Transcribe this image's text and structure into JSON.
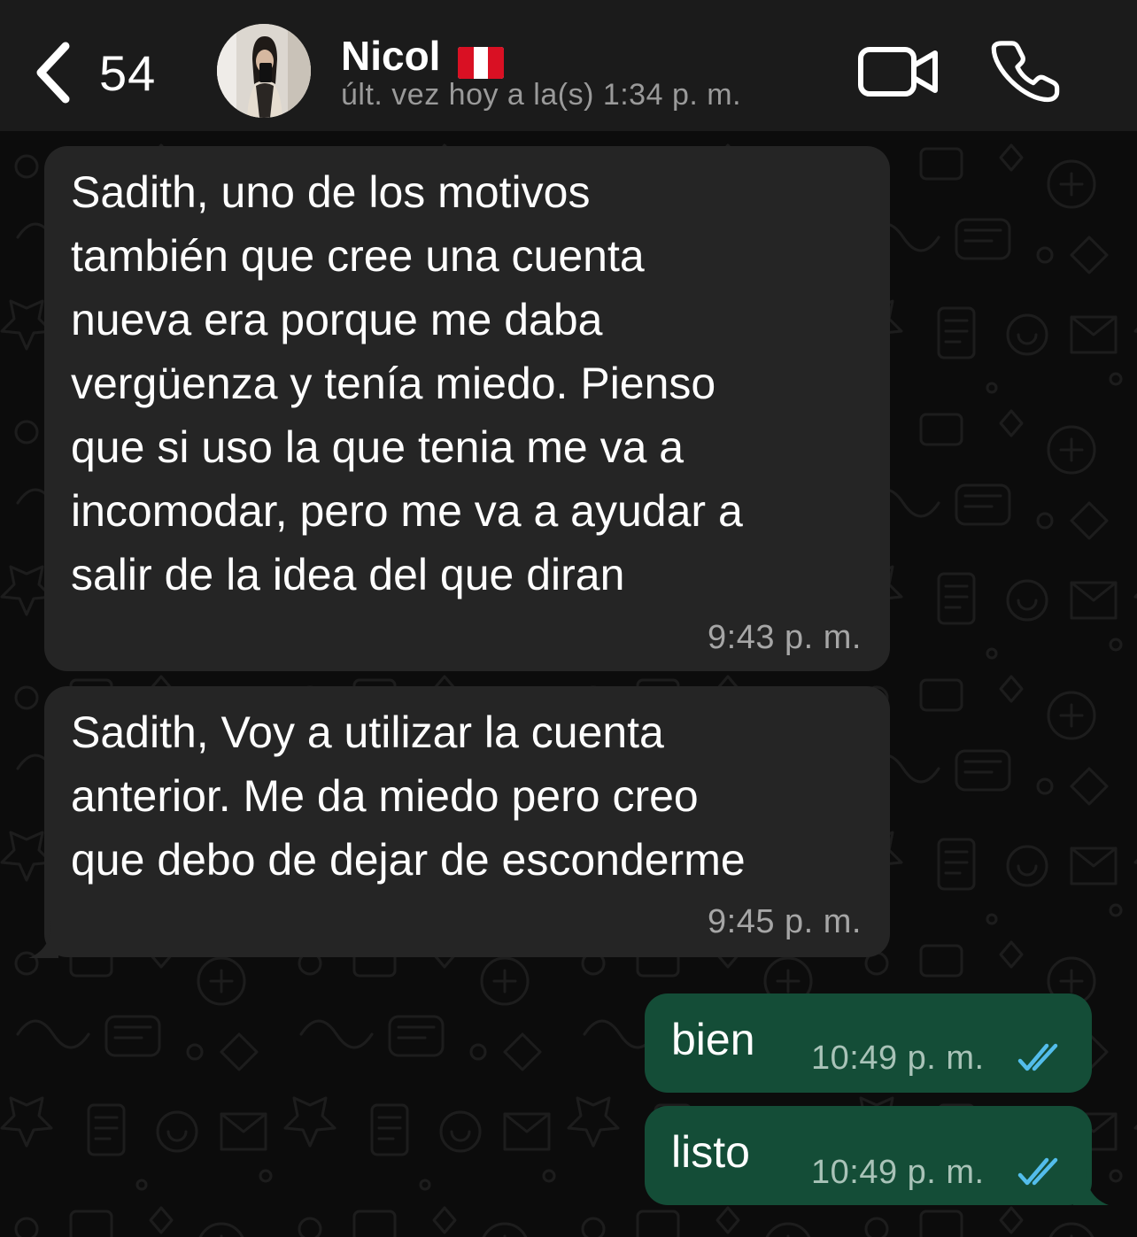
{
  "header": {
    "back_count": "54",
    "contact_name": "Nicol",
    "last_seen": "últ. vez hoy a la(s) 1:34 p. m."
  },
  "icons": {
    "back": "chevron-left-icon",
    "video_call": "video-camera-icon",
    "voice_call": "phone-icon",
    "flag": "peru-flag-icon",
    "read_receipt": "double-check-icon"
  },
  "colors": {
    "header_bg": "#1b1b1b",
    "incoming_bubble": "#252525",
    "outgoing_bubble": "#144d37",
    "read_ticks": "#53bdeb"
  },
  "messages": [
    {
      "direction": "incoming",
      "text": "Sadith, uno de los motivos\ntambién que cree una cuenta\nnueva era porque me daba\nvergüenza y tenía miedo. Pienso\nque si uso la que tenia me va a\nincomodar, pero me va a ayudar a\nsalir de la idea del que diran",
      "time": "9:43 p. m."
    },
    {
      "direction": "incoming",
      "text": "Sadith, Voy a utilizar la cuenta\nanterior. Me da miedo pero creo\nque debo de dejar de esconderme",
      "time": "9:45 p. m."
    },
    {
      "direction": "outgoing",
      "text": "bien",
      "time": "10:49 p. m.",
      "status": "read"
    },
    {
      "direction": "outgoing",
      "text": "listo",
      "time": "10:49 p. m.",
      "status": "read"
    }
  ]
}
